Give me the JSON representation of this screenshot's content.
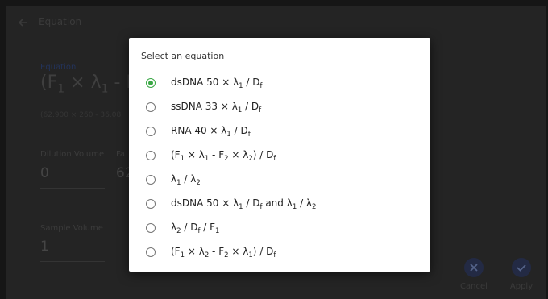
{
  "header": {
    "title": "Equation"
  },
  "equation_panel": {
    "label": "Equation",
    "value_visible": "(F1 × λ1 - F2",
    "calculation_visible": "(62.900 × 260 - 36.08"
  },
  "fields": {
    "dilution_label": "Dilution Volume",
    "dilution_value": "0",
    "factor_label_visible": "Fa",
    "factor_value_visible": "62",
    "sample_label": "Sample Volume",
    "sample_value": "1"
  },
  "actions": {
    "cancel_label": "Cancel",
    "apply_label": "Apply"
  },
  "dialog": {
    "title": "Select an equation",
    "selected_index": 0,
    "options": [
      "dsDNA 50 × λ1 / Df",
      "ssDNA 33 × λ1 / Df",
      "RNA 40 × λ1 / Df",
      "(F1 × λ1 - F2 × λ2) / Df",
      "λ1 / λ2",
      "dsDNA 50 × λ1 / Df and λ1 / λ2",
      "λ2 / Df / F1",
      "(F1 × λ2 - F2 × λ1) / Df"
    ]
  },
  "colors": {
    "accent_green": "#3aa845",
    "backdrop": "#242424",
    "dialog_bg": "#ffffff"
  },
  "icons": [
    "back-arrow-icon",
    "close-icon",
    "check-icon"
  ]
}
